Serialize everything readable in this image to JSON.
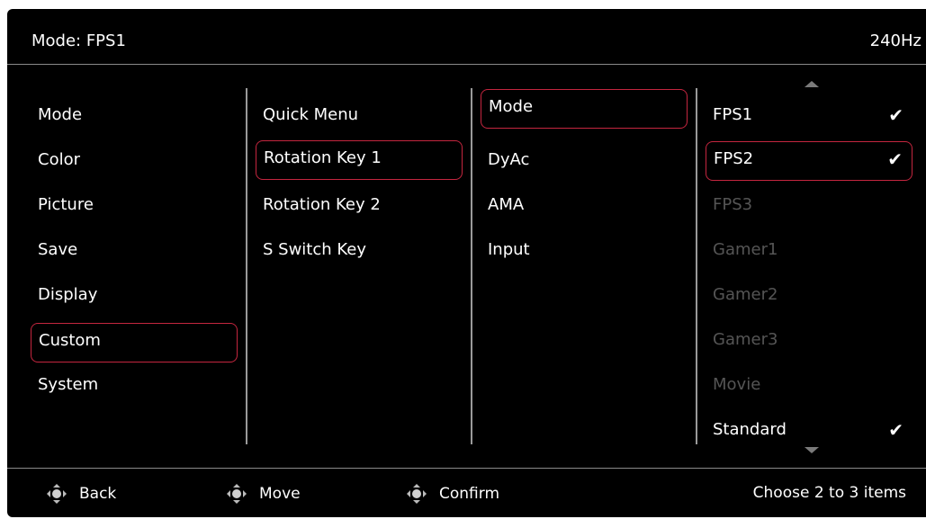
{
  "header": {
    "title": "Mode: FPS1",
    "refresh_rate": "240Hz"
  },
  "menu": {
    "items": [
      {
        "label": "Mode"
      },
      {
        "label": "Color"
      },
      {
        "label": "Picture"
      },
      {
        "label": "Save"
      },
      {
        "label": "Display"
      },
      {
        "label": "Custom",
        "selected": true
      },
      {
        "label": "System"
      }
    ]
  },
  "submenu": {
    "items": [
      {
        "label": "Quick Menu"
      },
      {
        "label": "Rotation Key 1",
        "selected": true
      },
      {
        "label": "Rotation Key 2"
      },
      {
        "label": "S Switch Key"
      }
    ]
  },
  "options": {
    "items": [
      {
        "label": "Mode",
        "selected": true
      },
      {
        "label": "DyAc"
      },
      {
        "label": "AMA"
      },
      {
        "label": "Input"
      }
    ]
  },
  "values": {
    "items": [
      {
        "label": "FPS1",
        "checked": true
      },
      {
        "label": "FPS2",
        "checked": true,
        "selected": true
      },
      {
        "label": "FPS3",
        "dim": true
      },
      {
        "label": "Gamer1",
        "dim": true
      },
      {
        "label": "Gamer2",
        "dim": true
      },
      {
        "label": "Gamer3",
        "dim": true
      },
      {
        "label": "Movie",
        "dim": true
      },
      {
        "label": "Standard",
        "checked": true
      }
    ],
    "check_glyph": "✔"
  },
  "footer": {
    "back_label": "Back",
    "move_label": "Move",
    "confirm_label": "Confirm",
    "hint": "Choose 2 to 3 items"
  },
  "colors": {
    "accent": "#c4263f",
    "background": "#000000",
    "text": "#ffffff",
    "dim": "#555555"
  }
}
